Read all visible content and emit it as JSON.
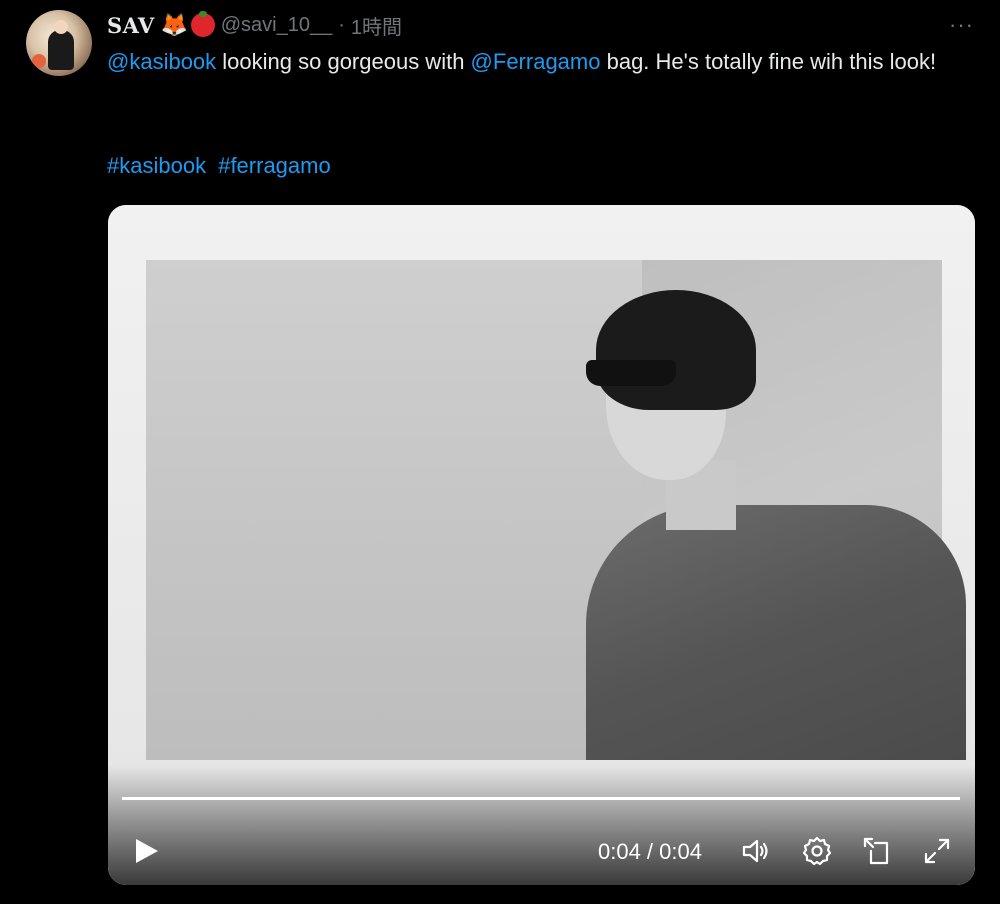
{
  "author": {
    "display_name": "SAV",
    "emoji_1": "fox-emoji",
    "emoji_2": "tomato-emoji",
    "handle": "@savi_10__",
    "separator": "·",
    "timestamp": "1時間"
  },
  "more_label": "···",
  "tweet": {
    "mention_1": "@kasibook",
    "text_1": " looking so gorgeous with ",
    "mention_2": "@Ferragamo",
    "text_2": " bag. He's totally fine wih this look!",
    "hashtags": [
      "#kasibook",
      "#ferragamo"
    ]
  },
  "video": {
    "time_display": "0:04 / 0:04",
    "progress": 1.0,
    "icons": [
      "play-icon",
      "volume-icon",
      "settings-icon",
      "pip-icon",
      "fullscreen-icon"
    ]
  },
  "colors": {
    "link": "#1d9bf0",
    "muted": "#71767b",
    "text": "#e7e9ea",
    "background": "#000000"
  }
}
